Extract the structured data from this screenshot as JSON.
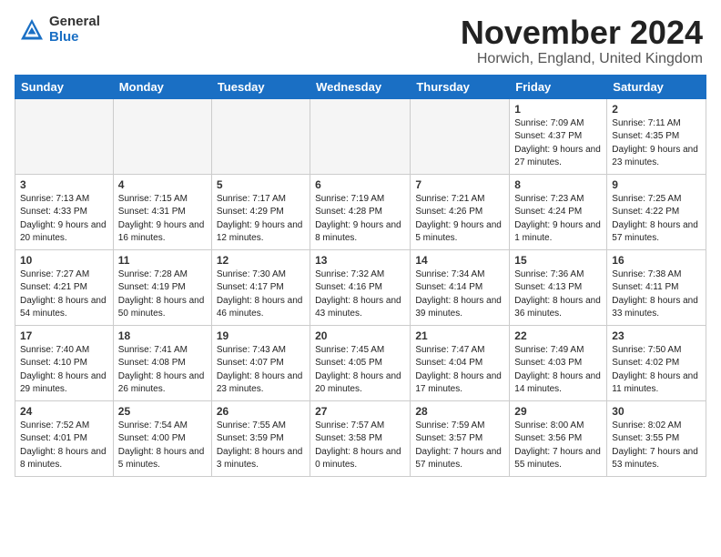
{
  "header": {
    "logo_general": "General",
    "logo_blue": "Blue",
    "month_title": "November 2024",
    "location": "Horwich, England, United Kingdom"
  },
  "days_of_week": [
    "Sunday",
    "Monday",
    "Tuesday",
    "Wednesday",
    "Thursday",
    "Friday",
    "Saturday"
  ],
  "weeks": [
    [
      {
        "day": "",
        "info": ""
      },
      {
        "day": "",
        "info": ""
      },
      {
        "day": "",
        "info": ""
      },
      {
        "day": "",
        "info": ""
      },
      {
        "day": "",
        "info": ""
      },
      {
        "day": "1",
        "info": "Sunrise: 7:09 AM\nSunset: 4:37 PM\nDaylight: 9 hours and 27 minutes."
      },
      {
        "day": "2",
        "info": "Sunrise: 7:11 AM\nSunset: 4:35 PM\nDaylight: 9 hours and 23 minutes."
      }
    ],
    [
      {
        "day": "3",
        "info": "Sunrise: 7:13 AM\nSunset: 4:33 PM\nDaylight: 9 hours and 20 minutes."
      },
      {
        "day": "4",
        "info": "Sunrise: 7:15 AM\nSunset: 4:31 PM\nDaylight: 9 hours and 16 minutes."
      },
      {
        "day": "5",
        "info": "Sunrise: 7:17 AM\nSunset: 4:29 PM\nDaylight: 9 hours and 12 minutes."
      },
      {
        "day": "6",
        "info": "Sunrise: 7:19 AM\nSunset: 4:28 PM\nDaylight: 9 hours and 8 minutes."
      },
      {
        "day": "7",
        "info": "Sunrise: 7:21 AM\nSunset: 4:26 PM\nDaylight: 9 hours and 5 minutes."
      },
      {
        "day": "8",
        "info": "Sunrise: 7:23 AM\nSunset: 4:24 PM\nDaylight: 9 hours and 1 minute."
      },
      {
        "day": "9",
        "info": "Sunrise: 7:25 AM\nSunset: 4:22 PM\nDaylight: 8 hours and 57 minutes."
      }
    ],
    [
      {
        "day": "10",
        "info": "Sunrise: 7:27 AM\nSunset: 4:21 PM\nDaylight: 8 hours and 54 minutes."
      },
      {
        "day": "11",
        "info": "Sunrise: 7:28 AM\nSunset: 4:19 PM\nDaylight: 8 hours and 50 minutes."
      },
      {
        "day": "12",
        "info": "Sunrise: 7:30 AM\nSunset: 4:17 PM\nDaylight: 8 hours and 46 minutes."
      },
      {
        "day": "13",
        "info": "Sunrise: 7:32 AM\nSunset: 4:16 PM\nDaylight: 8 hours and 43 minutes."
      },
      {
        "day": "14",
        "info": "Sunrise: 7:34 AM\nSunset: 4:14 PM\nDaylight: 8 hours and 39 minutes."
      },
      {
        "day": "15",
        "info": "Sunrise: 7:36 AM\nSunset: 4:13 PM\nDaylight: 8 hours and 36 minutes."
      },
      {
        "day": "16",
        "info": "Sunrise: 7:38 AM\nSunset: 4:11 PM\nDaylight: 8 hours and 33 minutes."
      }
    ],
    [
      {
        "day": "17",
        "info": "Sunrise: 7:40 AM\nSunset: 4:10 PM\nDaylight: 8 hours and 29 minutes."
      },
      {
        "day": "18",
        "info": "Sunrise: 7:41 AM\nSunset: 4:08 PM\nDaylight: 8 hours and 26 minutes."
      },
      {
        "day": "19",
        "info": "Sunrise: 7:43 AM\nSunset: 4:07 PM\nDaylight: 8 hours and 23 minutes."
      },
      {
        "day": "20",
        "info": "Sunrise: 7:45 AM\nSunset: 4:05 PM\nDaylight: 8 hours and 20 minutes."
      },
      {
        "day": "21",
        "info": "Sunrise: 7:47 AM\nSunset: 4:04 PM\nDaylight: 8 hours and 17 minutes."
      },
      {
        "day": "22",
        "info": "Sunrise: 7:49 AM\nSunset: 4:03 PM\nDaylight: 8 hours and 14 minutes."
      },
      {
        "day": "23",
        "info": "Sunrise: 7:50 AM\nSunset: 4:02 PM\nDaylight: 8 hours and 11 minutes."
      }
    ],
    [
      {
        "day": "24",
        "info": "Sunrise: 7:52 AM\nSunset: 4:01 PM\nDaylight: 8 hours and 8 minutes."
      },
      {
        "day": "25",
        "info": "Sunrise: 7:54 AM\nSunset: 4:00 PM\nDaylight: 8 hours and 5 minutes."
      },
      {
        "day": "26",
        "info": "Sunrise: 7:55 AM\nSunset: 3:59 PM\nDaylight: 8 hours and 3 minutes."
      },
      {
        "day": "27",
        "info": "Sunrise: 7:57 AM\nSunset: 3:58 PM\nDaylight: 8 hours and 0 minutes."
      },
      {
        "day": "28",
        "info": "Sunrise: 7:59 AM\nSunset: 3:57 PM\nDaylight: 7 hours and 57 minutes."
      },
      {
        "day": "29",
        "info": "Sunrise: 8:00 AM\nSunset: 3:56 PM\nDaylight: 7 hours and 55 minutes."
      },
      {
        "day": "30",
        "info": "Sunrise: 8:02 AM\nSunset: 3:55 PM\nDaylight: 7 hours and 53 minutes."
      }
    ]
  ]
}
